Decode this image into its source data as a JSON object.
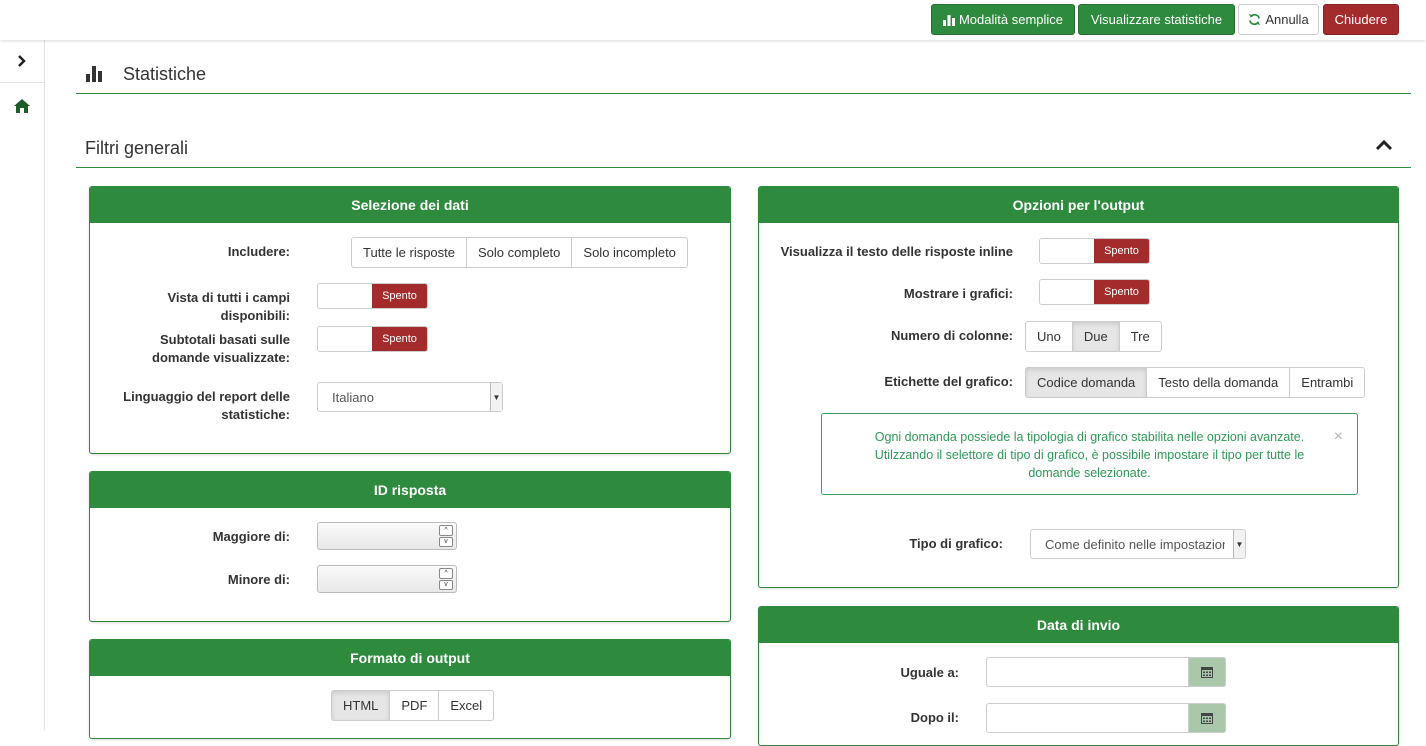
{
  "topbar": {
    "simple_mode": "Modalità semplice",
    "view_stats": "Visualizzare statistiche",
    "cancel": "Annulla",
    "close": "Chiudere"
  },
  "page": {
    "title": "Statistiche"
  },
  "section": {
    "title": "Filtri generali"
  },
  "data_selection": {
    "title": "Selezione dei dati",
    "include_label": "Includere:",
    "include_options": [
      "Tutte le risposte",
      "Solo completo",
      "Solo incompleto"
    ],
    "all_fields_label": "Vista di tutti i campi disponibili:",
    "all_fields_state": "Spento",
    "subtotals_label": "Subtotali basati sulle domande visualizzate:",
    "subtotals_state": "Spento",
    "language_label": "Linguaggio del report delle statistiche:",
    "language_value": "Italiano"
  },
  "response_id": {
    "title": "ID risposta",
    "greater_label": "Maggiore di:",
    "less_label": "Minore di:"
  },
  "output_format": {
    "title": "Formato di output",
    "options": [
      "HTML",
      "PDF",
      "Excel"
    ],
    "selected": "HTML"
  },
  "output_options": {
    "title": "Opzioni per l'output",
    "inline_label": "Visualizza il testo delle risposte inline",
    "inline_state": "Spento",
    "charts_label": "Mostrare i grafici:",
    "charts_state": "Spento",
    "columns_label": "Numero di colonne:",
    "columns_options": [
      "Uno",
      "Due",
      "Tre"
    ],
    "columns_selected": "Due",
    "chart_labels_label": "Etichette del grafico:",
    "chart_labels_options": [
      "Codice domanda",
      "Testo della domanda",
      "Entrambi"
    ],
    "chart_labels_selected": "Codice domanda",
    "alert_text": "Ogni domanda possiede la tipologia di grafico stabilita nelle opzioni avanzate. Utilzzando il selettore di tipo di grafico, è possibile impostare il tipo per tutte le domande selezionate.",
    "alert_close": "×",
    "chart_type_label": "Tipo di grafico:",
    "chart_type_value": "Come definito nelle impostazioni"
  },
  "submit_date": {
    "title": "Data di invio",
    "equal_label": "Uguale a:",
    "after_label": "Dopo il:"
  },
  "colors": {
    "green": "#2e8b3e",
    "red": "#a32b2b"
  }
}
